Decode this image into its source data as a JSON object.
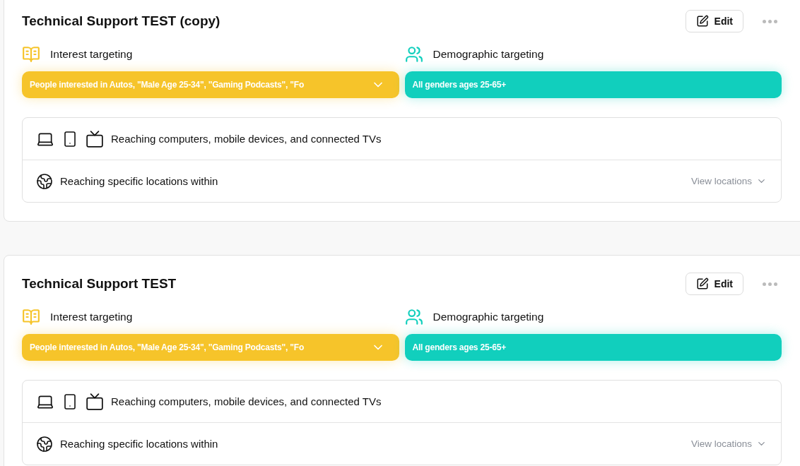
{
  "campaigns": [
    {
      "title": "Technical Support TEST (copy)",
      "edit_label": "Edit",
      "targeting": [
        {
          "kind": "interest",
          "label": "Interest targeting",
          "value": "People interested in Autos, \"Male Age 25-34\", \"Gaming Podcasts\", \"Fo",
          "color": "#f6c42a"
        },
        {
          "kind": "demographic",
          "label": "Demographic targeting",
          "value": "All genders ages 25-65+",
          "color": "#11cfbd"
        }
      ],
      "reach": [
        {
          "kind": "devices",
          "text": "Reaching computers, mobile devices, and connected TVs"
        },
        {
          "kind": "locations",
          "text": "Reaching specific locations within",
          "link": "View locations"
        }
      ]
    },
    {
      "title": "Technical Support TEST",
      "edit_label": "Edit",
      "targeting": [
        {
          "kind": "interest",
          "label": "Interest targeting",
          "value": "People interested in Autos, \"Male Age 25-34\", \"Gaming Podcasts\", \"Fo",
          "color": "#f6c42a"
        },
        {
          "kind": "demographic",
          "label": "Demographic targeting",
          "value": "All genders ages 25-65+",
          "color": "#11cfbd"
        }
      ],
      "reach": [
        {
          "kind": "devices",
          "text": "Reaching computers, mobile devices, and connected TVs"
        },
        {
          "kind": "locations",
          "text": "Reaching specific locations within",
          "link": "View locations"
        }
      ]
    }
  ]
}
